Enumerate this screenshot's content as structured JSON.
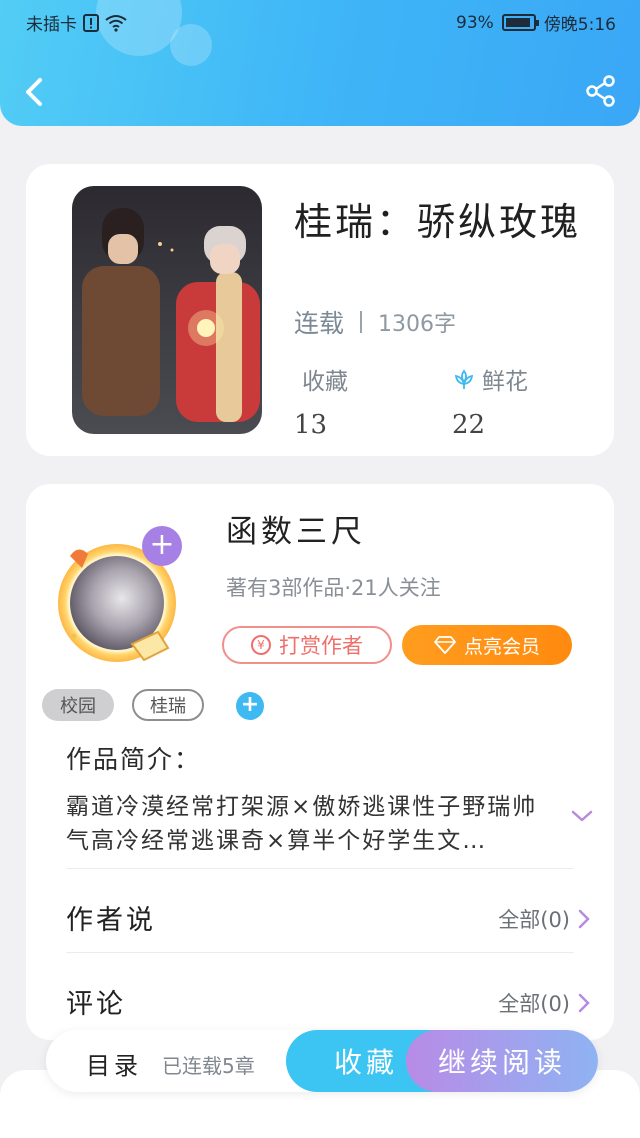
{
  "status_bar": {
    "carrier": "未插卡",
    "battery_text": "93%",
    "battery_level": 0.93,
    "time": "傍晚5:16"
  },
  "book": {
    "title": "桂瑞：骄纵玫瑰",
    "status": "连载",
    "word_count": "1306字",
    "favorites_label": "收藏",
    "favorites_count": "13",
    "flowers_label": "鲜花",
    "flowers_count": "22"
  },
  "author": {
    "name": "函数三尺",
    "meta": "著有3部作品·21人关注",
    "tip_label": "打赏作者",
    "vip_label": "点亮会员",
    "tags": [
      "校园",
      "桂瑞"
    ]
  },
  "intro": {
    "label": "作品简介：",
    "text": "霸道冷漠经常打架源×傲娇逃课性子野瑞帅气高冷经常逃课奇×算半个好学生文…"
  },
  "rows": {
    "author_says_label": "作者说",
    "author_says_count": "全部(0)",
    "comments_label": "评论",
    "comments_count": "全部(0)"
  },
  "bottom": {
    "toc_label": "目录",
    "chapters_text": "已连载5章",
    "favorite_label": "收藏",
    "continue_label": "继续阅读"
  },
  "colors": {
    "header_blue": "#3fb6f7",
    "vip_orange": "#ff9d1f",
    "tip_red": "#ef6f6b",
    "accent_purple": "#a780e6",
    "favorite_button": "#3cc4f2"
  },
  "icons": [
    "back-arrow-icon",
    "share-icon",
    "flower-icon",
    "yen-icon",
    "diamond-icon",
    "plus-icon",
    "chevron-down-icon",
    "chevron-right-icon",
    "wifi-icon",
    "battery-icon"
  ]
}
